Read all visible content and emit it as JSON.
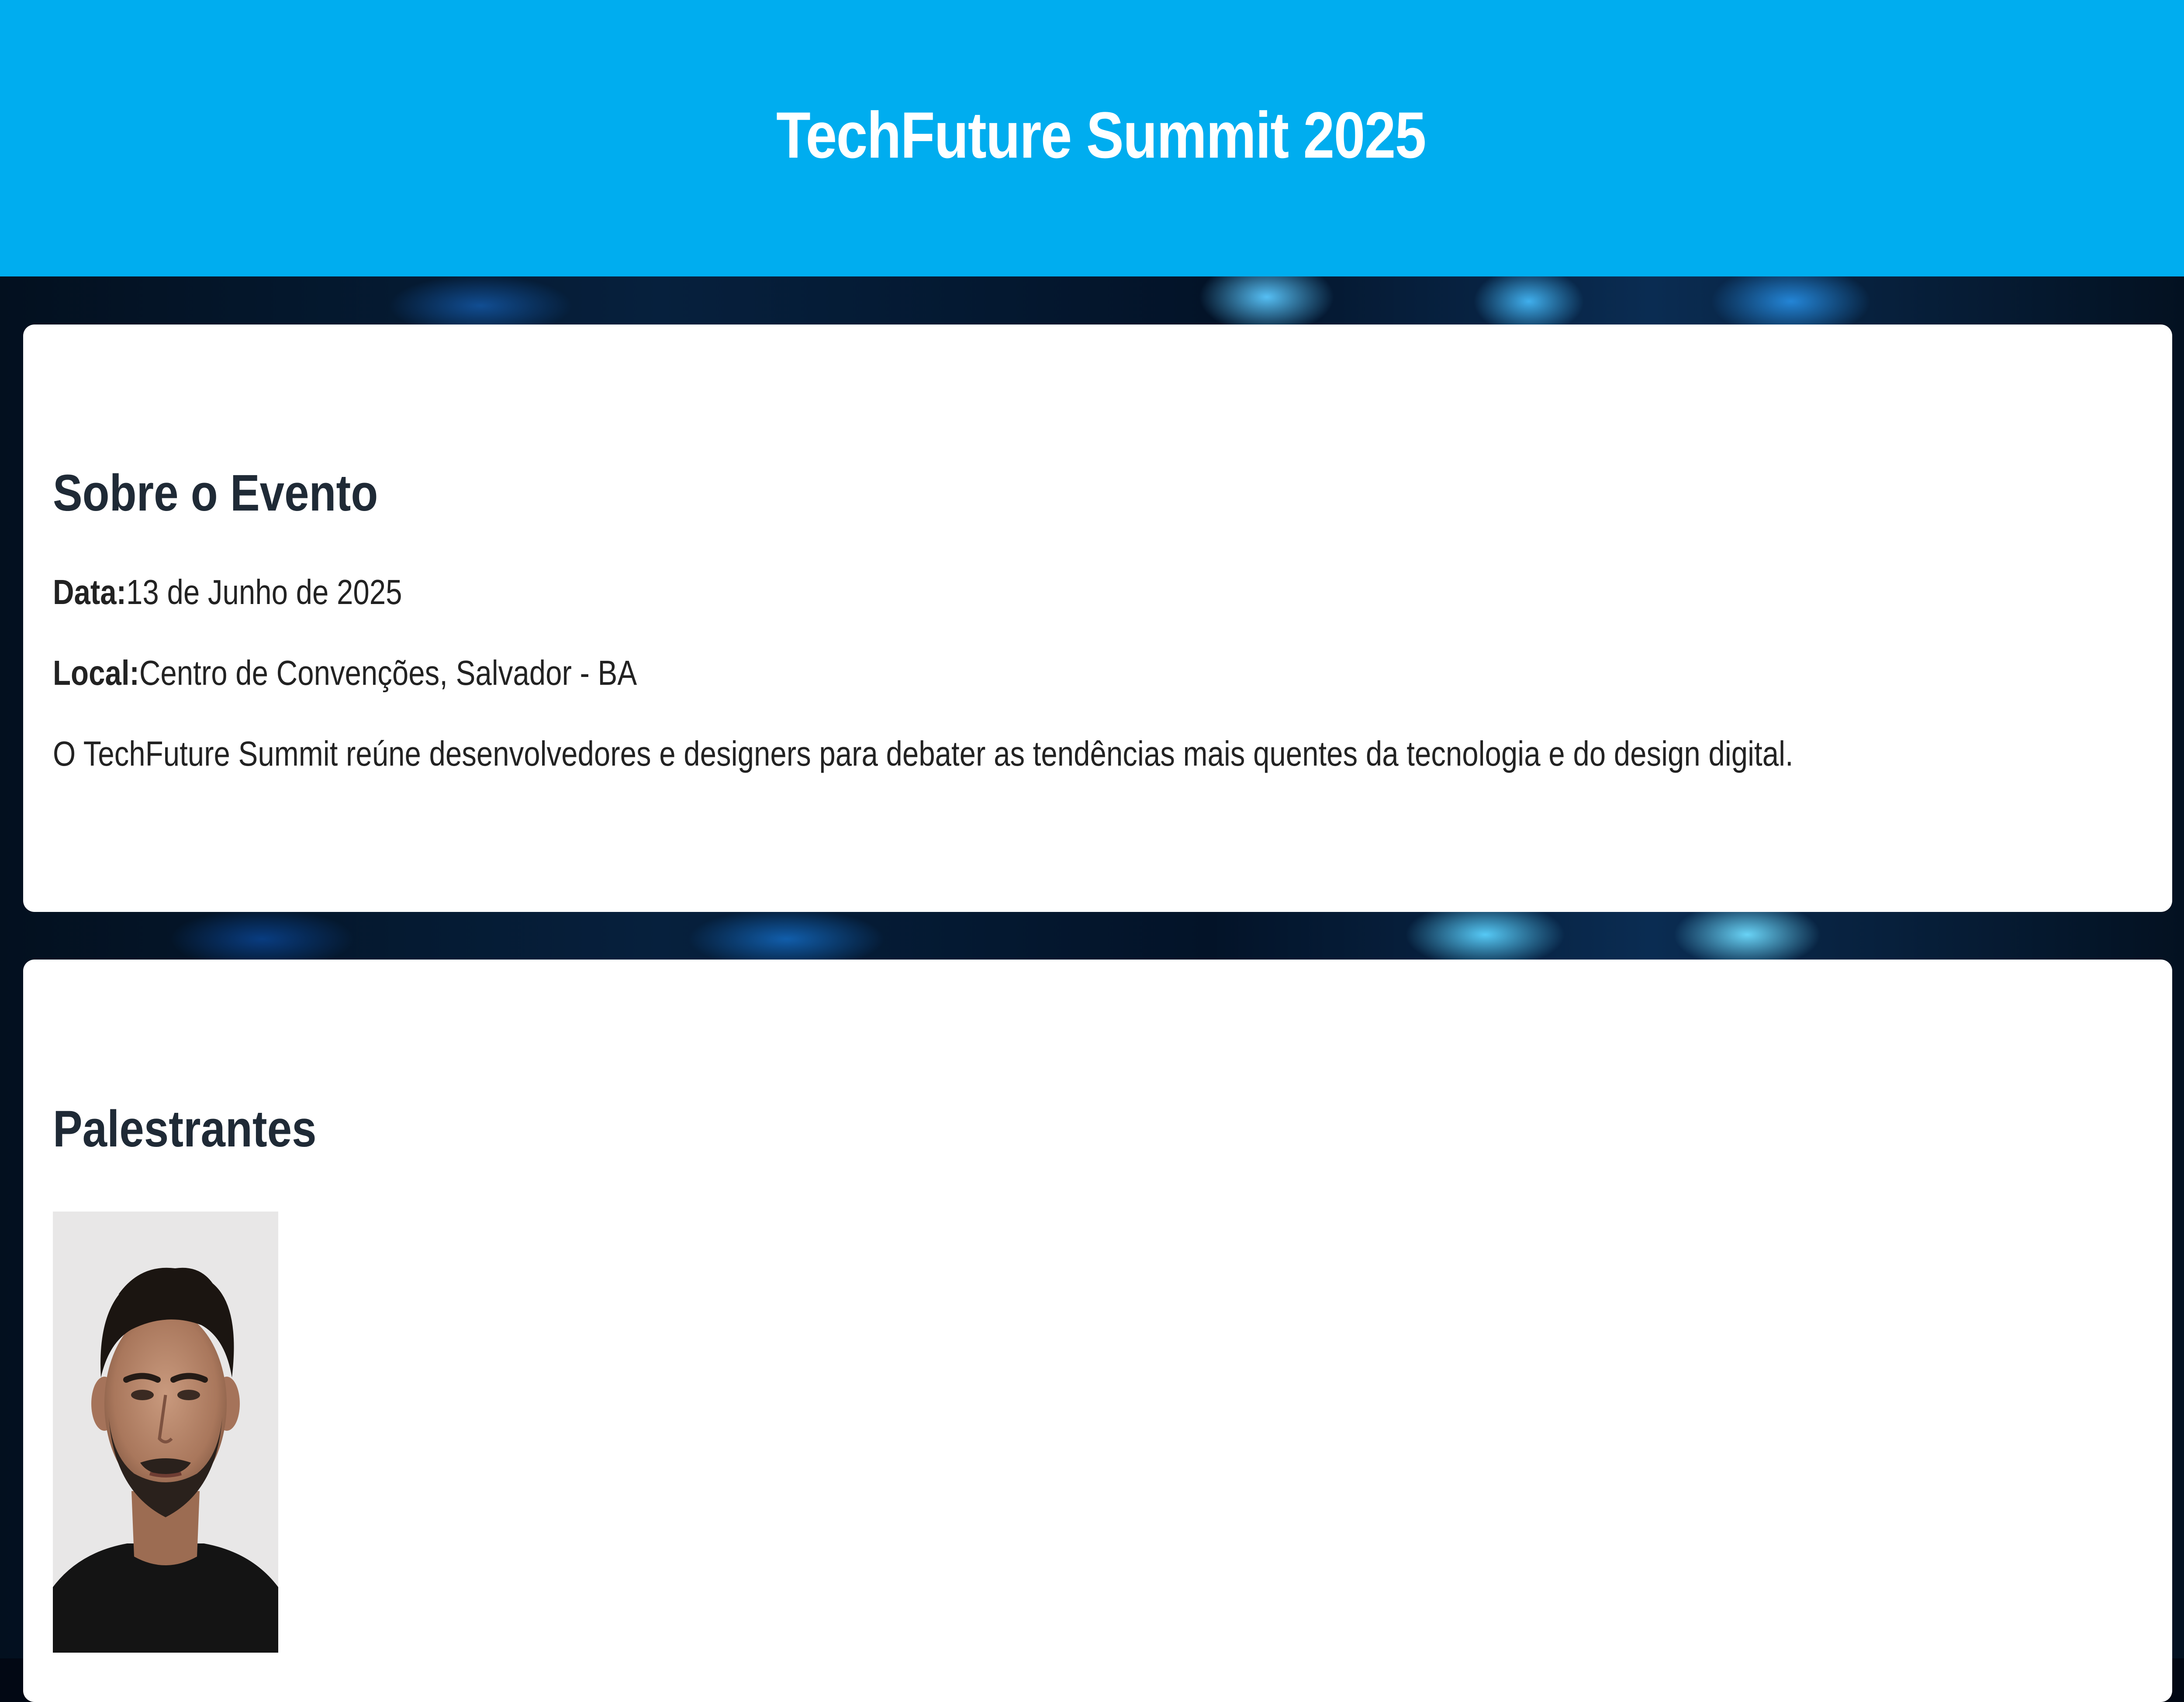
{
  "header": {
    "title": "TechFuture Summit 2025"
  },
  "about": {
    "heading": "Sobre o Evento",
    "date_label": "Data:",
    "date_value": "13 de Junho de 2025",
    "location_label": "Local:",
    "location_value": "Centro de Convenções, Salvador - BA",
    "description": "O TechFuture Summit reúne desenvolvedores e designers para debater as tendências mais quentes da tecnologia e do design digital."
  },
  "speakers": {
    "heading": "Palestrantes"
  },
  "colors": {
    "header_bg": "#00adef",
    "card_bg": "#ffffff",
    "heading_text": "#1f2a36"
  }
}
